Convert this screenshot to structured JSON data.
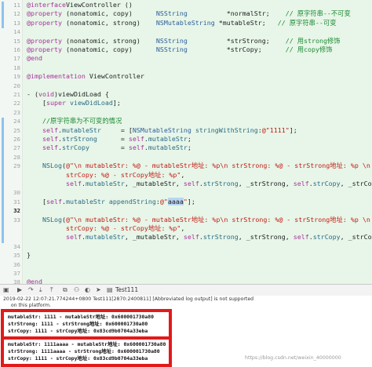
{
  "editor": {
    "lines": [
      {
        "n": "11",
        "parts": [
          [
            "k",
            "@interface"
          ],
          [
            "",
            "ViewController ()"
          ]
        ]
      },
      {
        "n": "12",
        "parts": [
          [
            "k",
            "@property"
          ],
          [
            "",
            " (nonatomic, copy)      "
          ],
          [
            "t",
            "NSString"
          ],
          [
            "",
            "          *normalStr;    "
          ],
          [
            "c",
            "// 原字符串--不可变"
          ]
        ]
      },
      {
        "n": "13",
        "parts": [
          [
            "k",
            "@property"
          ],
          [
            "",
            " (nonatomic, strong)    "
          ],
          [
            "t",
            "NSMutableString"
          ],
          [
            "",
            " *mutableStr;   "
          ],
          [
            "c",
            "// 原字符串--可变"
          ]
        ]
      },
      {
        "n": "14",
        "parts": []
      },
      {
        "n": "15",
        "parts": [
          [
            "k",
            "@property"
          ],
          [
            "",
            " (nonatomic, strong)    "
          ],
          [
            "t",
            "NSString"
          ],
          [
            "",
            "          *strStrong;    "
          ],
          [
            "c",
            "// 用strong修饰"
          ]
        ]
      },
      {
        "n": "16",
        "parts": [
          [
            "k",
            "@property"
          ],
          [
            "",
            " (nonatomic, copy)      "
          ],
          [
            "t",
            "NSString"
          ],
          [
            "",
            "          *strCopy;      "
          ],
          [
            "c",
            "// 用copy修饰"
          ]
        ]
      },
      {
        "n": "17",
        "parts": [
          [
            "k",
            "@end"
          ]
        ]
      },
      {
        "n": "18",
        "parts": []
      },
      {
        "n": "19",
        "parts": [
          [
            "k",
            "@implementation"
          ],
          [
            "",
            " ViewController"
          ]
        ]
      },
      {
        "n": "20",
        "parts": []
      },
      {
        "n": "21",
        "parts": [
          [
            "",
            "- ("
          ],
          [
            "k",
            "void"
          ],
          [
            "",
            ")viewDidLoad {"
          ]
        ]
      },
      {
        "n": "22",
        "parts": [
          [
            "",
            "    ["
          ],
          [
            "k",
            "super"
          ],
          [
            "",
            " "
          ],
          [
            "m",
            "viewDidLoad"
          ],
          [
            "",
            "];"
          ]
        ]
      },
      {
        "n": "23",
        "parts": []
      },
      {
        "n": "24",
        "parts": [
          [
            "",
            "    "
          ],
          [
            "c",
            "//原字符串为不可变的情况"
          ]
        ]
      },
      {
        "n": "25",
        "parts": [
          [
            "",
            "    "
          ],
          [
            "k",
            "self"
          ],
          [
            "",
            "."
          ],
          [
            "m",
            "mutableStr"
          ],
          [
            "",
            "     = ["
          ],
          [
            "t",
            "NSMutableString"
          ],
          [
            "",
            " "
          ],
          [
            "m",
            "stringWithString"
          ],
          [
            "",
            ":"
          ],
          [
            "s",
            "@\"1111\""
          ],
          [
            "",
            "];"
          ]
        ]
      },
      {
        "n": "26",
        "parts": [
          [
            "",
            "    "
          ],
          [
            "k",
            "self"
          ],
          [
            "",
            "."
          ],
          [
            "m",
            "strStrong"
          ],
          [
            "",
            "      = "
          ],
          [
            "k",
            "self"
          ],
          [
            "",
            "."
          ],
          [
            "m",
            "mutableStr"
          ],
          [
            "",
            ";"
          ]
        ]
      },
      {
        "n": "27",
        "parts": [
          [
            "",
            "    "
          ],
          [
            "k",
            "self"
          ],
          [
            "",
            "."
          ],
          [
            "m",
            "strCopy"
          ],
          [
            "",
            "        = "
          ],
          [
            "k",
            "self"
          ],
          [
            "",
            "."
          ],
          [
            "m",
            "mutableStr"
          ],
          [
            "",
            ";"
          ]
        ]
      },
      {
        "n": "28",
        "parts": []
      },
      {
        "n": "29",
        "parts": [
          [
            "",
            "    "
          ],
          [
            "m",
            "NSLog"
          ],
          [
            "",
            "("
          ],
          [
            "s",
            "@\"\\n mutableStr: %@ - mutableStr地址: %p\\n strStrong: %@ - strStrong地址: %p \\n"
          ]
        ]
      },
      {
        "n": "",
        "parts": [
          [
            "s",
            "          strCopy: %@ - strCopy地址: %p\""
          ],
          [
            "",
            ","
          ]
        ]
      },
      {
        "n": "",
        "parts": [
          [
            "",
            "          "
          ],
          [
            "k",
            "self"
          ],
          [
            "",
            "."
          ],
          [
            "m",
            "mutableStr"
          ],
          [
            "",
            ", _mutableStr, "
          ],
          [
            "k",
            "self"
          ],
          [
            "",
            "."
          ],
          [
            "m",
            "strStrong"
          ],
          [
            "",
            ", _strStrong, "
          ],
          [
            "k",
            "self"
          ],
          [
            "",
            "."
          ],
          [
            "m",
            "strCopy"
          ],
          [
            "",
            ", _strCopy);"
          ]
        ]
      },
      {
        "n": "30",
        "parts": []
      },
      {
        "n": "31",
        "parts": [
          [
            "",
            "    ["
          ],
          [
            "k",
            "self"
          ],
          [
            "",
            "."
          ],
          [
            "m",
            "mutableStr"
          ],
          [
            "",
            " "
          ],
          [
            "m",
            "appendString"
          ],
          [
            "",
            ":"
          ],
          [
            "s",
            "@\""
          ],
          [
            "hl",
            "aaaa"
          ],
          [
            "s",
            "\""
          ],
          [
            "",
            "];"
          ]
        ]
      },
      {
        "n": "32",
        "bold": true,
        "parts": []
      },
      {
        "n": "33",
        "parts": [
          [
            "",
            "    "
          ],
          [
            "m",
            "NSLog"
          ],
          [
            "",
            "("
          ],
          [
            "s",
            "@\"\\n mutableStr: %@ - mutableStr地址: %p\\n strStrong: %@ - strStrong地址: %p \\n"
          ]
        ]
      },
      {
        "n": "",
        "parts": [
          [
            "s",
            "          strCopy: %@ - strCopy地址: %p\""
          ],
          [
            "",
            ","
          ]
        ]
      },
      {
        "n": "",
        "parts": [
          [
            "",
            "          "
          ],
          [
            "k",
            "self"
          ],
          [
            "",
            "."
          ],
          [
            "m",
            "mutableStr"
          ],
          [
            "",
            ", _mutableStr, "
          ],
          [
            "k",
            "self"
          ],
          [
            "",
            "."
          ],
          [
            "m",
            "strStrong"
          ],
          [
            "",
            ", _strStrong, "
          ],
          [
            "k",
            "self"
          ],
          [
            "",
            "."
          ],
          [
            "m",
            "strCopy"
          ],
          [
            "",
            ", _strCopy);"
          ]
        ]
      },
      {
        "n": "34",
        "parts": []
      },
      {
        "n": "35",
        "parts": [
          [
            "",
            "}"
          ]
        ]
      },
      {
        "n": "36",
        "parts": []
      },
      {
        "n": "37",
        "parts": []
      },
      {
        "n": "38",
        "parts": [
          [
            "k",
            "@end"
          ]
        ]
      },
      {
        "n": "39",
        "parts": []
      }
    ]
  },
  "toolbar": {
    "scheme": "Test111",
    "icons": [
      "hide-console-icon",
      "continue-icon",
      "step-over-icon",
      "step-into-icon",
      "step-out-icon",
      "view-debugger-icon",
      "memory-graph-icon",
      "environment-icon",
      "location-icon",
      "scheme-icon"
    ]
  },
  "console": {
    "top_lines": [
      "2019-02-22 12:07:21.774244+0800 Test111[2870:2400811] [Abbreviated log output] is not supported",
      "     on this platform."
    ],
    "box1": [
      "mutableStr: 1111 - mutableStr地址: 0x600001730a80",
      "strStrong: 1111 - strStrong地址: 0x600001730a80",
      "strCopy: 1111 - strCopy地址: 0x83cd9b0704a33eba"
    ],
    "box2": [
      "mutableStr: 1111aaaa - mutableStr地址: 0x600001730a80",
      "strStrong: 1111aaaa - strStrong地址: 0x600001730a80",
      "strCopy: 1111 - strCopy地址: 0x83cd9b0704a33eba"
    ]
  },
  "watermark": "https://blog.csdn.net/weixin_40000000",
  "colors": {
    "editor_bg": "#e7f6e8",
    "keyword": "#a8329c",
    "comment": "#1f8a35",
    "string": "#c41a16",
    "type": "#2f5e9b",
    "highlight_border": "#e21a1a"
  }
}
